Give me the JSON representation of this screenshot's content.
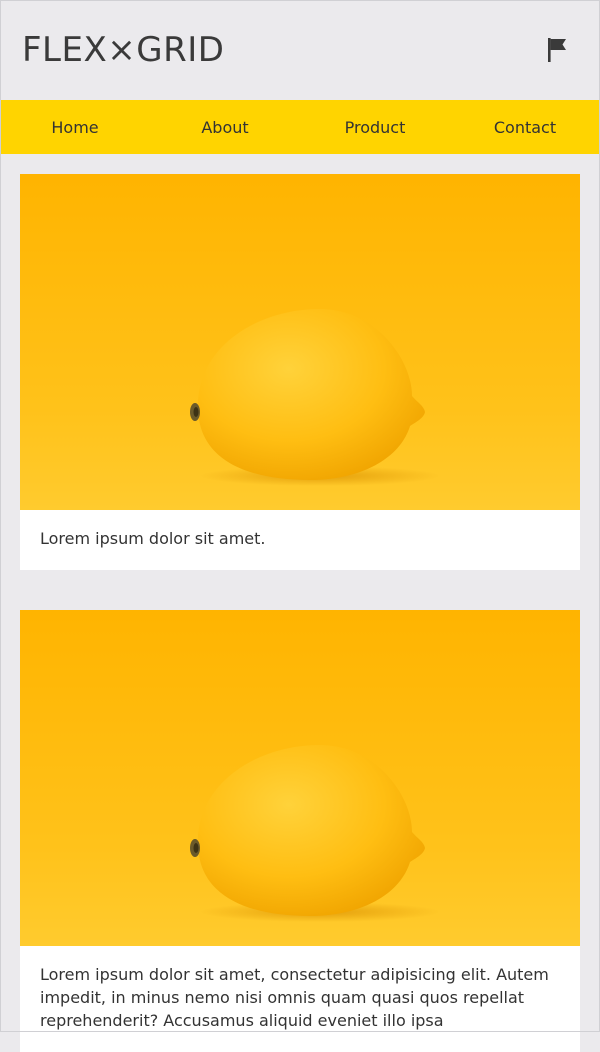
{
  "header": {
    "logo_text": "FLEX×GRID",
    "flag_icon": "flag-icon"
  },
  "nav": {
    "items": [
      {
        "label": "Home"
      },
      {
        "label": "About"
      },
      {
        "label": "Product"
      },
      {
        "label": "Contact"
      }
    ],
    "color": "#ffd400"
  },
  "cards": [
    {
      "image_icon": "lemon-photo",
      "text": "Lorem ipsum dolor sit amet."
    },
    {
      "image_icon": "lemon-photo",
      "text": "Lorem ipsum dolor sit amet, consectetur adipisicing elit. Autem impedit, in minus nemo nisi omnis quam quasi quos repellat reprehenderit? Accusamus aliquid eveniet illo ipsa"
    }
  ]
}
